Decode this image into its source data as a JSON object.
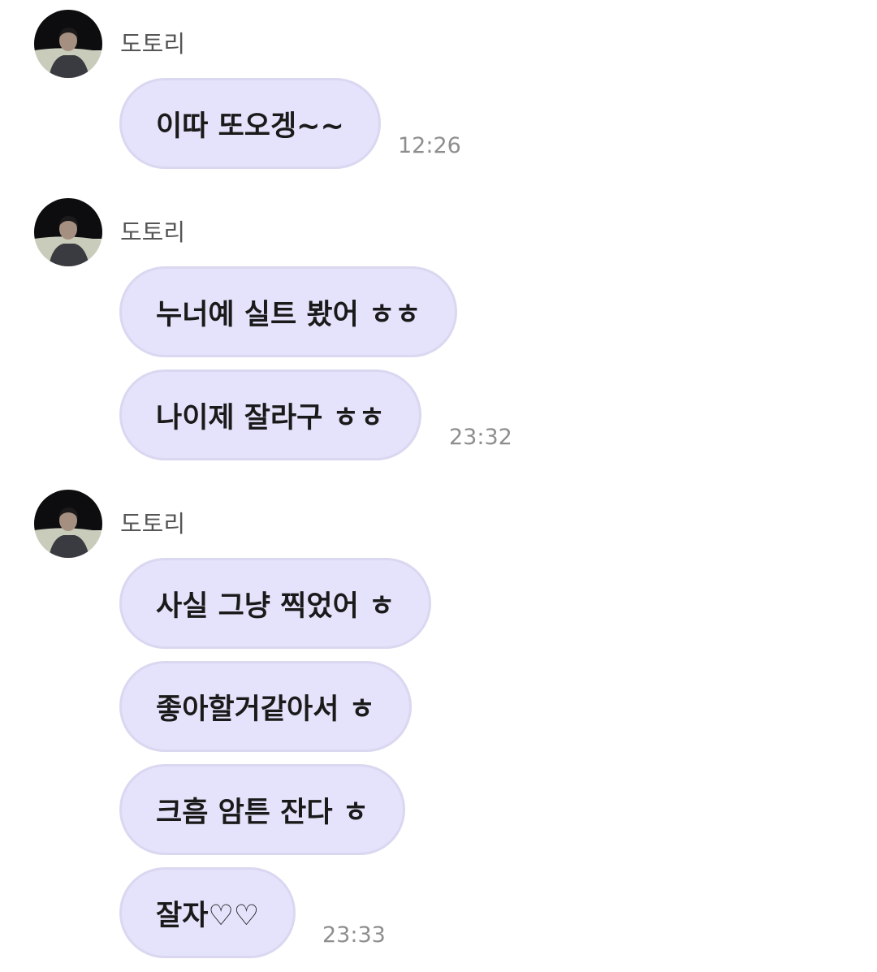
{
  "groups": [
    {
      "sender": "도토리",
      "messages": [
        "이따 또오겡~~"
      ],
      "time": "12:26"
    },
    {
      "sender": "도토리",
      "messages": [
        "누너예 실트 봤어 ㅎㅎ",
        "나이제 잘라구 ㅎㅎ"
      ],
      "time": "23:32"
    },
    {
      "sender": "도토리",
      "messages": [
        "사실 그냥 찍었어 ㅎ",
        "좋아할거같아서 ㅎ",
        "크흠 암튼 잔다 ㅎ",
        "잘자♡♡"
      ],
      "time": "23:33"
    }
  ],
  "colors": {
    "bubble_fill": "#e5e3fb",
    "bubble_border": "#dad7f1",
    "sender_text": "#555555",
    "time_text": "#8e8e8e",
    "message_text": "#1a1a1a"
  },
  "icons": {
    "avatar": "profile-photo-avatar"
  }
}
